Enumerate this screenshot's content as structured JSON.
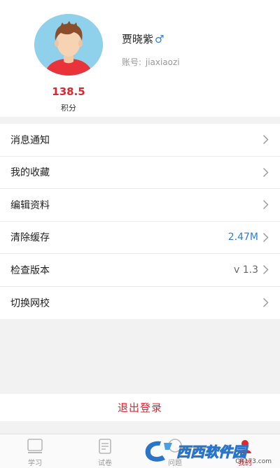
{
  "profile": {
    "username": "贾晓紫",
    "gender_symbol": "♂",
    "account_label": "账号:",
    "account_value": "jiaxiaozi",
    "points_value": "138.5",
    "points_label": "积分"
  },
  "menu": {
    "items": [
      {
        "label": "消息通知",
        "value": ""
      },
      {
        "label": "我的收藏",
        "value": ""
      },
      {
        "label": "编辑资料",
        "value": ""
      },
      {
        "label": "清除缓存",
        "value": "2.47M"
      },
      {
        "label": "检查版本",
        "value": "v 1.3"
      },
      {
        "label": "切换网校",
        "value": ""
      }
    ]
  },
  "logout_label": "退出登录",
  "tabbar": {
    "tabs": [
      {
        "label": "学习",
        "icon": "book-icon"
      },
      {
        "label": "试卷",
        "icon": "paper-icon"
      },
      {
        "label": "问题",
        "icon": "question-icon"
      },
      {
        "label": "我的",
        "icon": "user-icon"
      }
    ]
  },
  "watermark": {
    "text": "西西软件园",
    "sub": "CR173.com"
  },
  "colors": {
    "accent_red": "#e4252b",
    "value_blue": "#2a7fd4",
    "gender_blue": "#2d7fe0"
  }
}
